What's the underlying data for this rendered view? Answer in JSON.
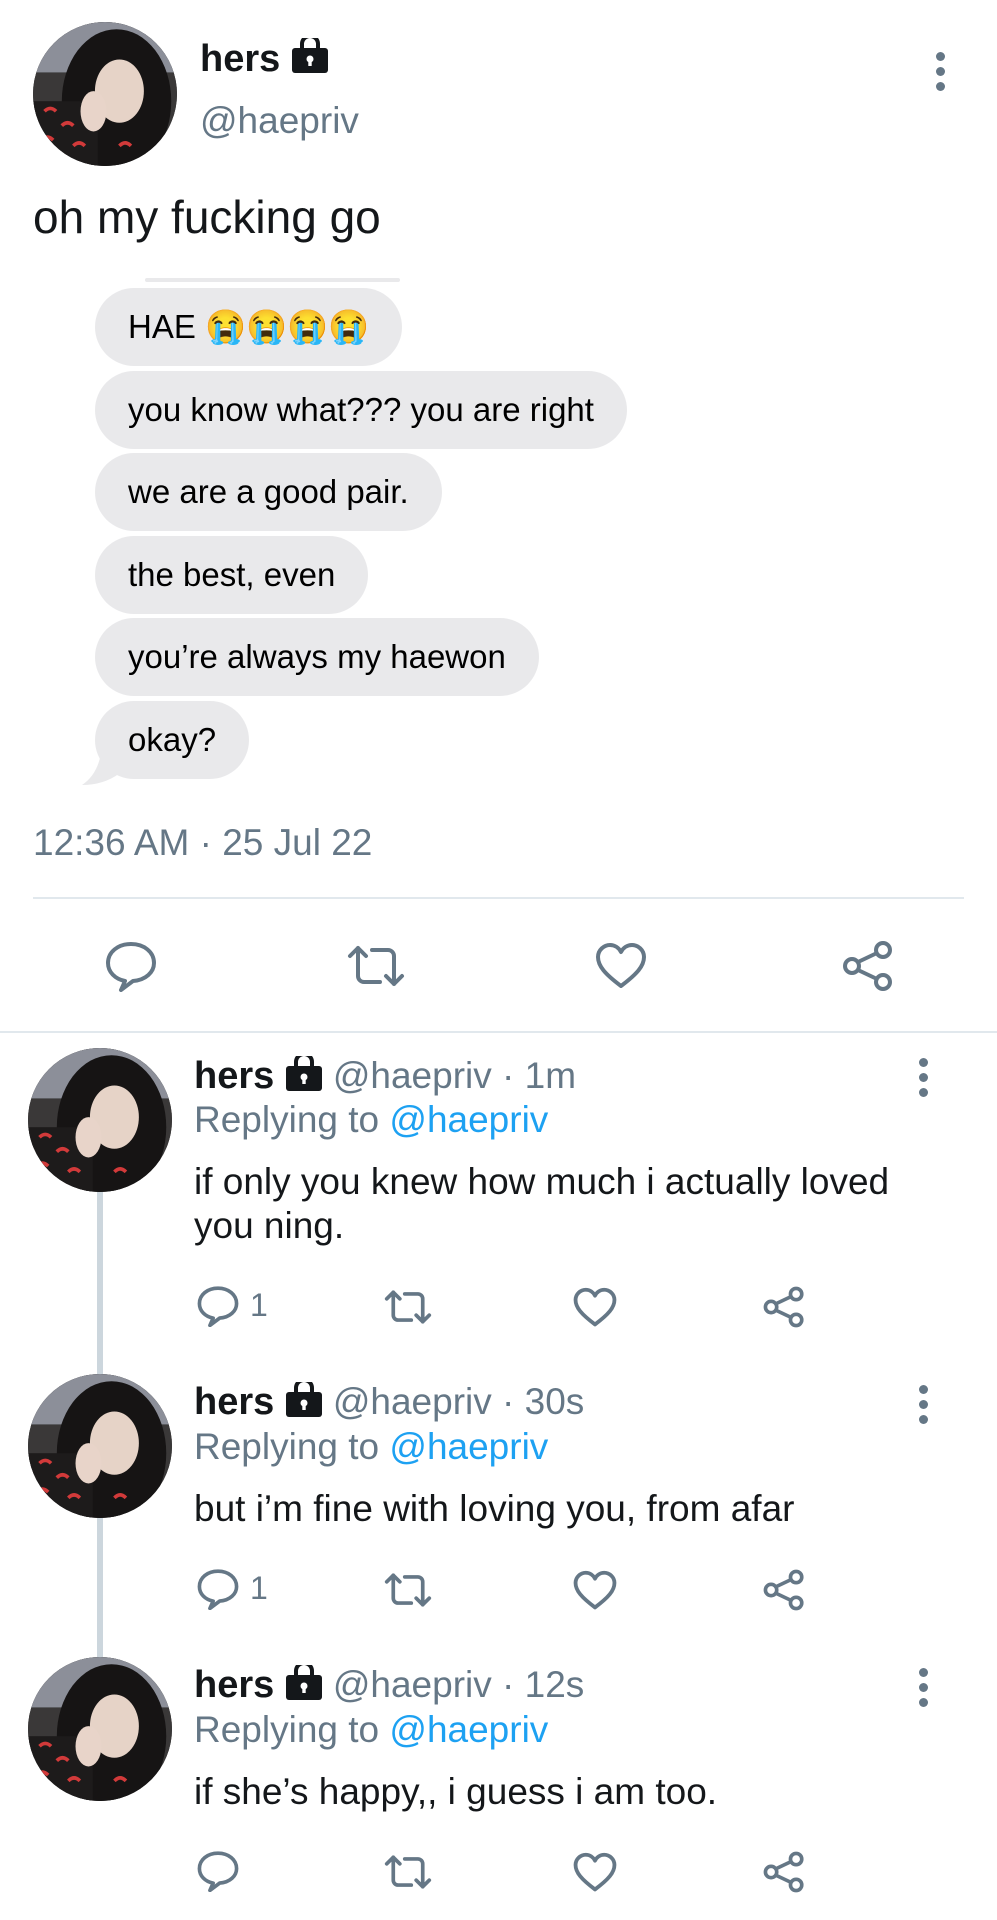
{
  "main_tweet": {
    "name": "hers",
    "handle": "@haepriv",
    "text": "oh my fucking go",
    "messages": [
      "HAE 😭😭😭😭",
      "you know what??? you are right",
      "we are a good pair.",
      "the best, even",
      "you’re always my haewon",
      "okay?"
    ],
    "timestamp": "12:36 AM · 25 Jul 22"
  },
  "replies": [
    {
      "name": "hers",
      "handle": "@haepriv",
      "time": "1m",
      "replying_label": "Replying to",
      "replying_to": "@haepriv",
      "text": "if only you knew how much i actually loved you ning.",
      "reply_count": "1"
    },
    {
      "name": "hers",
      "handle": "@haepriv",
      "time": "30s",
      "replying_label": "Replying to",
      "replying_to": "@haepriv",
      "text": "but i’m fine with loving you, from afar",
      "reply_count": "1"
    },
    {
      "name": "hers",
      "handle": "@haepriv",
      "time": "12s",
      "replying_label": "Replying to",
      "replying_to": "@haepriv",
      "text": "if she’s happy,, i guess i am too.",
      "reply_count": ""
    }
  ],
  "icons": {
    "reply": "reply-icon",
    "retweet": "retweet-icon",
    "like": "heart-icon",
    "share": "share-icon",
    "more": "more-vertical-icon",
    "lock": "lock-icon",
    "avatar": "avatar-image"
  },
  "colors": {
    "link": "#1da1f2",
    "secondary": "#657786",
    "bubble": "#e9e9eb",
    "divider": "#e1e8ed"
  }
}
